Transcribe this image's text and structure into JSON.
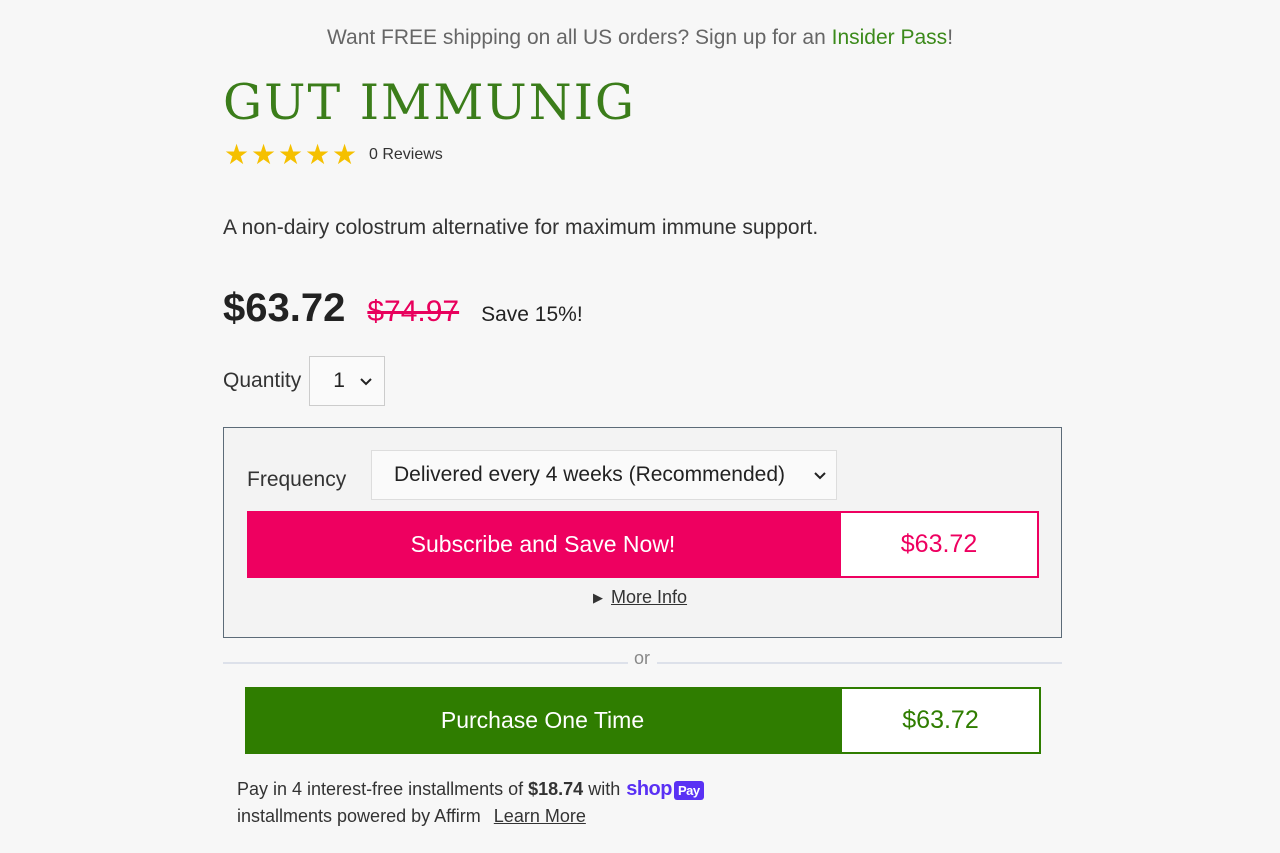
{
  "banner": {
    "text": "Want FREE shipping on all US orders? Sign up for an ",
    "link": "Insider Pass",
    "suffix": "!"
  },
  "product": {
    "title": "GUT IMMUNIG",
    "rating_stars": 5,
    "reviews": "0 Reviews",
    "description": "A non-dairy colostrum alternative for maximum immune support."
  },
  "pricing": {
    "price": "$63.72",
    "original_price": "$74.97",
    "save_text": "Save 15%!"
  },
  "quantity": {
    "label": "Quantity",
    "value": "1"
  },
  "subscription": {
    "frequency_label": "Frequency",
    "frequency_value": "Delivered every 4 weeks (Recommended)",
    "button_label": "Subscribe and Save Now!",
    "button_price": "$63.72",
    "more_info": "More Info"
  },
  "divider": {
    "text": "or"
  },
  "one_time": {
    "button_label": "Purchase One Time",
    "button_price": "$63.72"
  },
  "installments": {
    "prefix": "Pay in 4 interest-free installments of",
    "amount": "$18.74",
    "with": "with",
    "shop_logo": "shop",
    "pay_badge": "Pay",
    "affirm_text": "installments powered by Affirm",
    "learn_more": "Learn More"
  },
  "colors": {
    "brand_green": "#2f7d00",
    "accent_pink": "#ee0060",
    "star_yellow": "#f5c000",
    "shop_purple": "#5a31f4"
  }
}
